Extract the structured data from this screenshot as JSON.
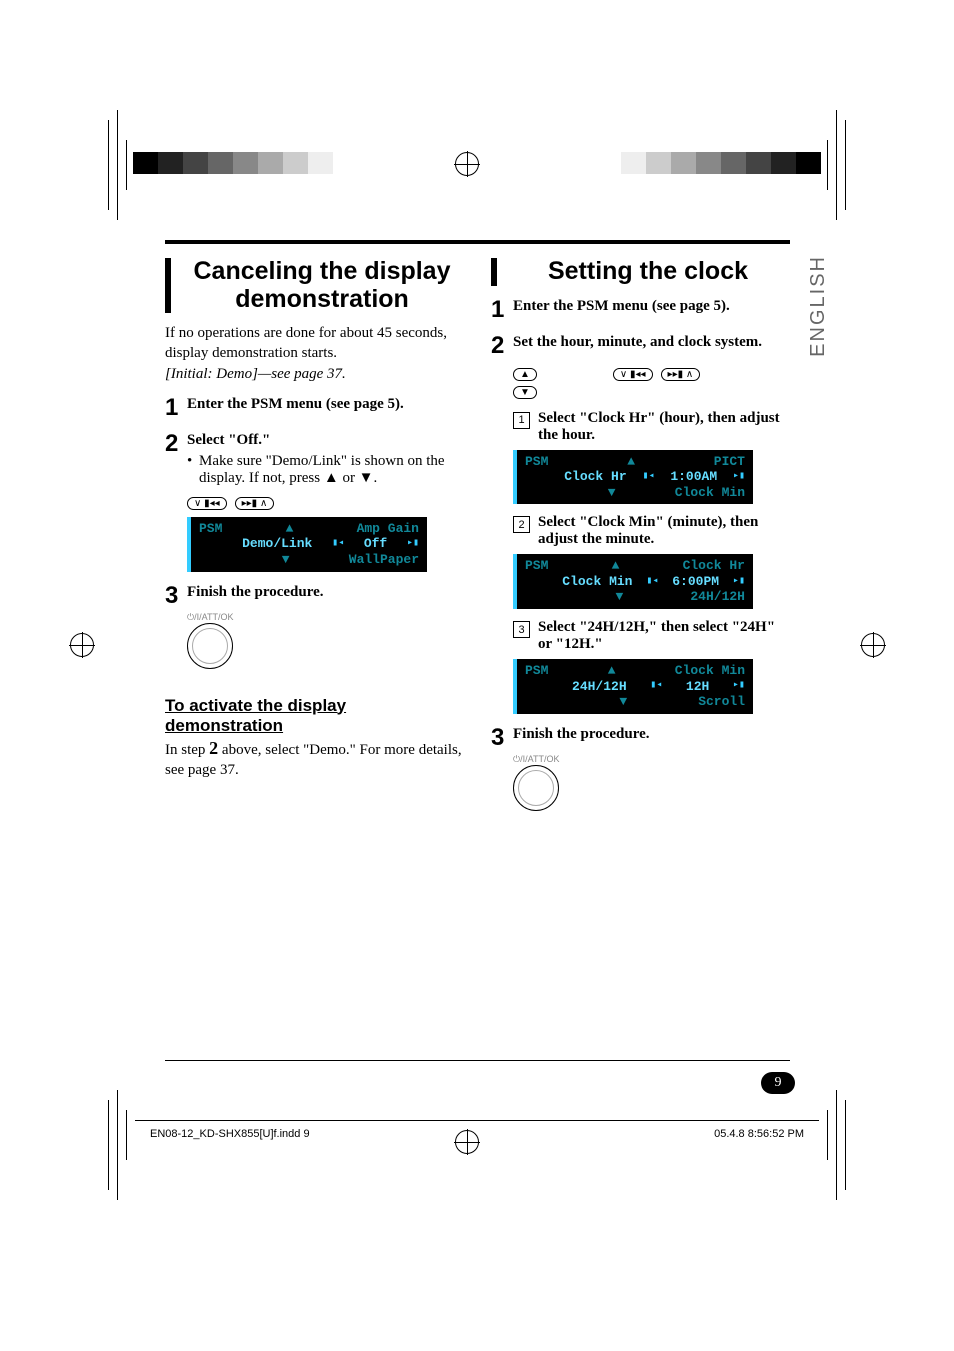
{
  "language_tab": "ENGLISH",
  "page_number": "9",
  "left": {
    "title": "Canceling the display demonstration",
    "intro1": "If no operations are done for about 45 seconds, display demonstration starts.",
    "intro2": "[Initial: Demo]—see page 37.",
    "step1": "Enter the PSM menu (see page 5).",
    "step2": "Select \"Off.\"",
    "step2_bullet": "Make sure \"Demo/Link\" is shown on the display. If not, press ▲ or ▼.",
    "lcd": {
      "badge": "PSM",
      "row_up": "Amp Gain",
      "row_sel": "Demo/Link",
      "row_val": "Off",
      "row_down": "WallPaper"
    },
    "step3": "Finish the procedure.",
    "knob_label": "/I/ATT/OK",
    "sub_head": "To activate the display demonstration",
    "sub_text_a": "In step ",
    "sub_text_num": "2",
    "sub_text_b": " above, select \"Demo.\" For more details, see page 37."
  },
  "right": {
    "title": "Setting the clock",
    "step1": "Enter the PSM menu (see page 5).",
    "step2": "Set the hour, minute, and clock system.",
    "sub1": "Select \"Clock Hr\" (hour), then adjust the hour.",
    "lcd1": {
      "badge": "PSM",
      "row_up": "PICT",
      "row_sel": "Clock Hr",
      "row_val": "1:00AM",
      "row_down": "Clock Min"
    },
    "sub2": "Select \"Clock Min\" (minute), then adjust the minute.",
    "lcd2": {
      "badge": "PSM",
      "row_up": "Clock Hr",
      "row_sel": "Clock Min",
      "row_val": "6:00PM",
      "row_down": "24H/12H"
    },
    "sub3": "Select \"24H/12H,\" then select \"24H\" or \"12H.\"",
    "lcd3": {
      "badge": "PSM",
      "row_up": "Clock Min",
      "row_sel": "24H/12H",
      "row_val": "12H",
      "row_down": "Scroll"
    },
    "step3": "Finish the procedure.",
    "knob_label": "/I/ATT/OK"
  },
  "footer": {
    "file": "EN08-12_KD-SHX855[U]f.indd   9",
    "timestamp": "05.4.8   8:56:52 PM"
  }
}
